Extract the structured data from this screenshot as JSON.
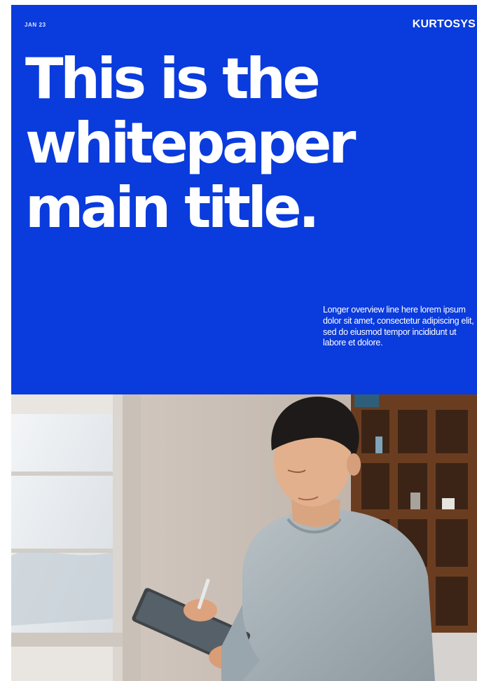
{
  "cover": {
    "date": "JAN 23",
    "brand": "KURTOSYS",
    "title_lines": [
      "This is the",
      "whitepaper",
      "main title."
    ],
    "overview": "Longer overview line here lorem ipsum dolor sit amet, consectetur adipiscing elit, sed do eiusmod tempor incididunt ut labore et dolore."
  },
  "photo": {
    "subject": "man-writing-on-tablet-icon"
  },
  "colors": {
    "cover_background": "#0a3bdc",
    "text": "#ffffff"
  }
}
